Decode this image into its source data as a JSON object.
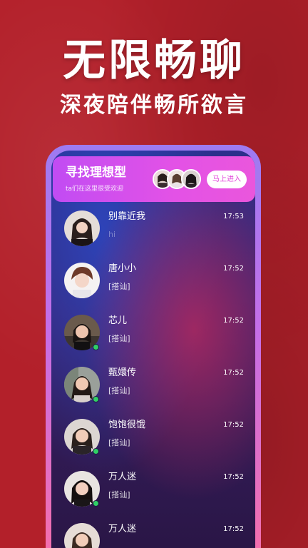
{
  "promo": {
    "headline": "无限畅聊",
    "subline": "深夜陪伴畅所欲言"
  },
  "banner": {
    "title": "寻找理想型",
    "subtitle": "ta们在这里很受欢迎",
    "enter_label": "马上进入"
  },
  "colors": {
    "background": "#b3202a",
    "online": "#2fd065",
    "accent": "#e352e6"
  },
  "chats": [
    {
      "name": "别靠近我",
      "time": "17:53",
      "preview": "hi",
      "online": false
    },
    {
      "name": "唐小小",
      "time": "17:52",
      "preview": "[搭讪]",
      "online": false
    },
    {
      "name": "芯儿",
      "time": "17:52",
      "preview": "[搭讪]",
      "online": true
    },
    {
      "name": "甄嬛传",
      "time": "17:52",
      "preview": "[搭讪]",
      "online": true
    },
    {
      "name": "饱饱很饿",
      "time": "17:52",
      "preview": "[搭讪]",
      "online": true
    },
    {
      "name": "万人迷",
      "time": "17:52",
      "preview": "[搭讪]",
      "online": true
    },
    {
      "name": "万人迷",
      "time": "17:52",
      "preview": "",
      "online": false
    }
  ]
}
